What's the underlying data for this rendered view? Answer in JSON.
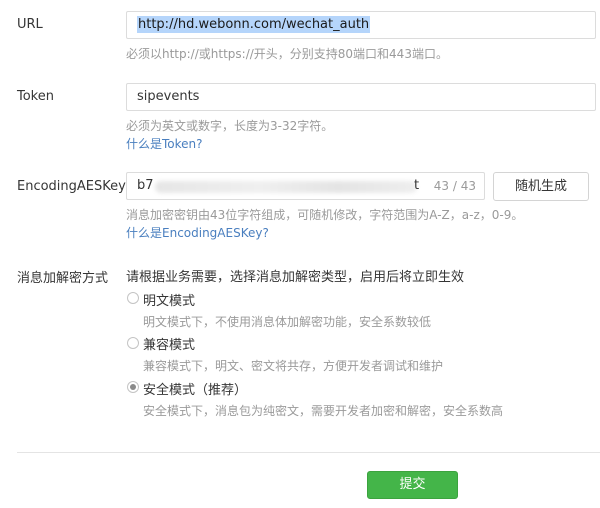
{
  "url_field": {
    "label": "URL",
    "value": "http://hd.webonn.com/wechat_auth",
    "hint": "必须以http://或https://开头，分别支持80端口和443端口。"
  },
  "token_field": {
    "label": "Token",
    "value": "sipevents",
    "hint": "必须为英文或数字，长度为3-32字符。",
    "help_link": "什么是Token?"
  },
  "aeskey_field": {
    "label": "EncodingAESKey",
    "value_prefix": "b7",
    "value_suffix": "t",
    "counter": "43 / 43",
    "generate_button": "随机生成",
    "hint": "消息加密密钥由43位字符组成，可随机修改，字符范围为A-Z，a-z，0-9。",
    "help_link": "什么是EncodingAESKey?"
  },
  "encryption_mode": {
    "label": "消息加解密方式",
    "intro": "请根据业务需要，选择消息加解密类型，启用后将立即生效",
    "options": [
      {
        "label": "明文模式",
        "description": "明文模式下，不使用消息体加解密功能，安全系数较低",
        "checked": false
      },
      {
        "label": "兼容模式",
        "description": "兼容模式下，明文、密文将共存，方便开发者调试和维护",
        "checked": false
      },
      {
        "label": "安全模式（推荐）",
        "description": "安全模式下，消息包为纯密文，需要开发者加密和解密，安全系数高",
        "checked": true
      }
    ]
  },
  "submit_button": "提交",
  "colors": {
    "accent_green": "#44b549",
    "link_blue": "#4a7fbf",
    "hint_gray": "#9a9a9a",
    "selection_blue": "#b5d5fb"
  }
}
